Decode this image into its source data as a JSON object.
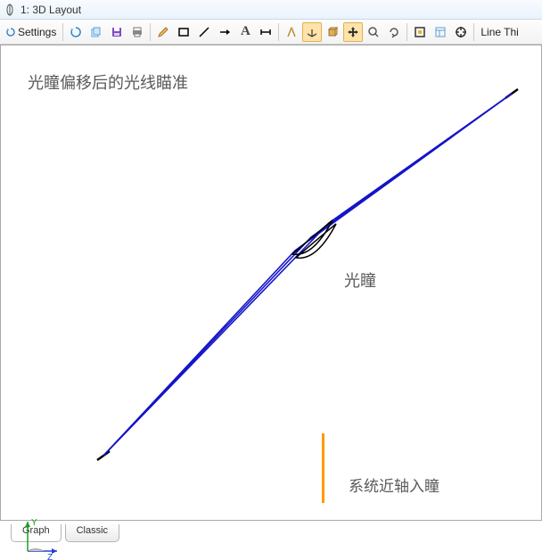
{
  "window": {
    "title": "1: 3D Layout"
  },
  "toolbar": {
    "settings_label": "Settings",
    "line_thickness_label": "Line Thi"
  },
  "canvas": {
    "title_annotation": "光瞳偏移后的光线瞄准",
    "pupil_label": "光瞳",
    "legend_label": "系统近轴入瞳",
    "axes": {
      "y_label": "Y",
      "z_label": "Z"
    }
  },
  "tabs": {
    "items": [
      {
        "label": "Graph",
        "active": true
      },
      {
        "label": "Classic",
        "active": false
      }
    ]
  }
}
